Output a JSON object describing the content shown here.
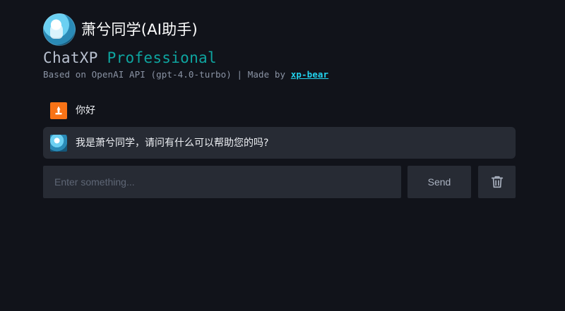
{
  "header": {
    "title": "萧兮同学(AI助手)",
    "avatar_icon": "bot-avatar-icon"
  },
  "brand": {
    "name_part1": "ChatXP",
    "name_part2": "Professional"
  },
  "subtitle": {
    "text": "Based on OpenAI API (gpt-4.0-turbo) | Made by ",
    "author": "xp-bear"
  },
  "messages": [
    {
      "role": "user",
      "avatar_icon": "user-avatar-icon",
      "text": "你好"
    },
    {
      "role": "assistant",
      "avatar_icon": "bot-avatar-icon",
      "text": "我是萧兮同学，请问有什么可以帮助您的吗?"
    }
  ],
  "composer": {
    "placeholder": "Enter something...",
    "value": "",
    "send_label": "Send",
    "clear_icon": "trash-icon"
  },
  "colors": {
    "background": "#11131a",
    "panel": "#272b34",
    "accent": "#0ea5a0",
    "link": "#22d3ee",
    "user_avatar": "#f97316"
  }
}
